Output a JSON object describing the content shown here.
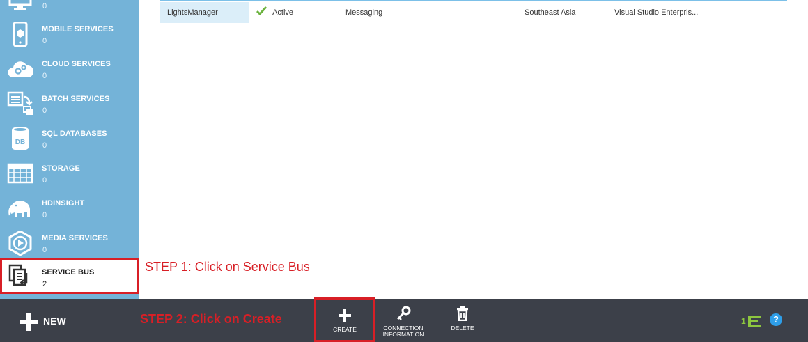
{
  "sidebar": {
    "items": [
      {
        "label": "",
        "count": "0",
        "icon": "monitor-icon"
      },
      {
        "label": "MOBILE SERVICES",
        "count": "0",
        "icon": "mobile-phone-icon"
      },
      {
        "label": "CLOUD SERVICES",
        "count": "0",
        "icon": "cloud-gears-icon"
      },
      {
        "label": "BATCH SERVICES",
        "count": "0",
        "icon": "batch-document-icon"
      },
      {
        "label": "SQL DATABASES",
        "count": "0",
        "icon": "database-icon"
      },
      {
        "label": "STORAGE",
        "count": "0",
        "icon": "table-grid-icon"
      },
      {
        "label": "HDINSIGHT",
        "count": "0",
        "icon": "elephant-icon"
      },
      {
        "label": "MEDIA SERVICES",
        "count": "0",
        "icon": "play-hexagon-icon"
      },
      {
        "label": "SERVICE BUS",
        "count": "2",
        "icon": "service-bus-icon"
      }
    ]
  },
  "table": {
    "rows": [
      {
        "name": "LightsManager",
        "status": "Active",
        "type": "Messaging",
        "region": "Southeast Asia",
        "subscription": "Visual Studio Enterpris..."
      }
    ]
  },
  "annotations": {
    "step1": "STEP 1: Click on Service Bus",
    "step2": "STEP 2: Click on Create"
  },
  "commandbar": {
    "new_label": "NEW",
    "create_label": "CREATE",
    "connection_label_1": "CONNECTION",
    "connection_label_2": "INFORMATION",
    "delete_label": "DELETE",
    "operations_count": "1",
    "help_label": "?"
  },
  "colors": {
    "sidebar_bg": "#74b3d8",
    "commandbar_bg": "#3c4049",
    "highlight_red": "#d81f26",
    "status_green": "#6cb33f",
    "help_blue": "#2e9ee8"
  }
}
